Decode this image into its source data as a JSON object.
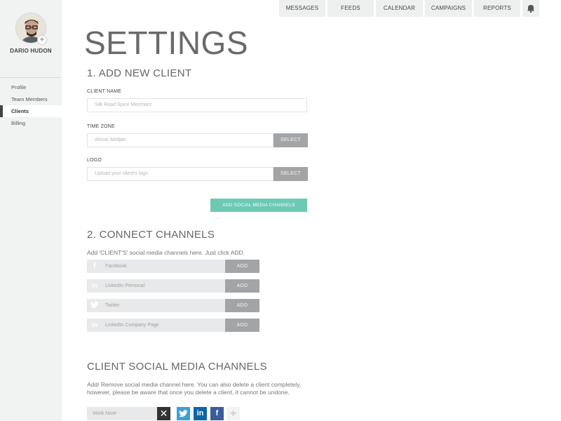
{
  "user": {
    "name": "DARIO HUDON"
  },
  "sidebar": {
    "items": [
      {
        "label": "Profile"
      },
      {
        "label": "Team Members"
      },
      {
        "label": "Clients"
      },
      {
        "label": "Billing"
      }
    ],
    "active": "Clients"
  },
  "topnav": {
    "items": [
      {
        "label": "MESSAGES"
      },
      {
        "label": "FEEDS"
      },
      {
        "label": "CALENDAR"
      },
      {
        "label": "CAMPAIGNS"
      },
      {
        "label": "REPORTS"
      }
    ],
    "bell_icon": "bell-icon"
  },
  "page": {
    "title": "SETTINGS"
  },
  "add_client": {
    "title": "1. ADD NEW CLIENT",
    "client_name_label": "CLIENT NAME",
    "client_name_placeholder": "Silk Road Spice Merchant",
    "timezone_label": "TIME ZONE",
    "timezone_value": "Africa/ Abidjan",
    "timezone_button": "SELECT",
    "logo_label": "LOGO",
    "logo_placeholder": "Upload your client's logo",
    "logo_button": "SELECT",
    "add_social_button": "ADD SOCIAL MEDIA CHANNELS"
  },
  "connect": {
    "title": "2. CONNECT CHANNELS",
    "helper": "Add 'CLIENT'S' social media channels here. Just click ADD.",
    "channels": [
      {
        "name": "Facebook",
        "icon": "facebook-icon",
        "button": "ADD"
      },
      {
        "name": "LinkedIn Personal",
        "icon": "linkedin-icon",
        "button": "ADD"
      },
      {
        "name": "Twitter",
        "icon": "twitter-icon",
        "button": "ADD"
      },
      {
        "name": "LinkedIn Company Page",
        "icon": "linkedin-icon",
        "button": "ADD"
      }
    ]
  },
  "client_channels": {
    "title": "CLIENT SOCIAL MEDIA CHANNELS",
    "helper_line1": "Add/ Remove social media channel here. You can also delete a client completely,",
    "helper_line2": "however, please be aware that once you delete a client, it cannot be undone.",
    "client_name": "Work Nicer",
    "icons": [
      "close-icon",
      "twitter-icon",
      "linkedin-icon",
      "facebook-icon",
      "plus-icon"
    ]
  },
  "colors": {
    "accent": "#6dc9b4",
    "button_gray": "#a3a4a6",
    "twitter": "#3aa0dc",
    "linkedin": "#0b66a6",
    "facebook": "#3a5b9c"
  }
}
